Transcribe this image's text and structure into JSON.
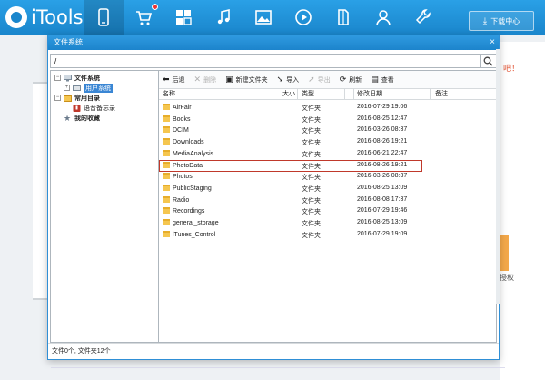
{
  "app": {
    "logo_text": "iTools",
    "download_label": "下载中心",
    "nav_icons": [
      "phone-icon",
      "store-icon",
      "apps-icon",
      "music-icon",
      "photos-icon",
      "video-icon",
      "books-icon",
      "contacts-icon",
      "tools-icon"
    ]
  },
  "background": {
    "warn_text": "吧！",
    "right_text": "授权"
  },
  "dialog": {
    "title": "文件系统",
    "close": "×",
    "path": "/",
    "tree": {
      "root": "文件系统",
      "user_system": "用户系统",
      "common_dirs": "常用目录",
      "voice_memos": "语音备忘录",
      "favorites": "我的收藏"
    },
    "toolbar": {
      "back": "后退",
      "delete": "删除",
      "new_folder": "新建文件夹",
      "import": "导入",
      "export": "导出",
      "refresh": "刷新",
      "view": "查看"
    },
    "columns": {
      "name": "名称",
      "size": "大小",
      "type": "类型",
      "modified": "修改日期",
      "note": "备注"
    },
    "rows": [
      {
        "name": "AirFair",
        "type": "文件夹",
        "modified": "2016-07-29 19:06"
      },
      {
        "name": "Books",
        "type": "文件夹",
        "modified": "2016-08-25 12:47"
      },
      {
        "name": "DCIM",
        "type": "文件夹",
        "modified": "2016-03-26 08:37"
      },
      {
        "name": "Downloads",
        "type": "文件夹",
        "modified": "2016-08-26 19:21"
      },
      {
        "name": "MediaAnalysis",
        "type": "文件夹",
        "modified": "2016-06-21 22:47"
      },
      {
        "name": "PhotoData",
        "type": "文件夹",
        "modified": "2016-08-26 19:21"
      },
      {
        "name": "Photos",
        "type": "文件夹",
        "modified": "2016-03-26 08:37"
      },
      {
        "name": "PublicStaging",
        "type": "文件夹",
        "modified": "2016-08-25 13:09"
      },
      {
        "name": "Radio",
        "type": "文件夹",
        "modified": "2016-08-08 17:37"
      },
      {
        "name": "Recordings",
        "type": "文件夹",
        "modified": "2016-07-29 19:46"
      },
      {
        "name": "general_storage",
        "type": "文件夹",
        "modified": "2016-08-25 13:09"
      },
      {
        "name": "iTunes_Control",
        "type": "文件夹",
        "modified": "2016-07-29 19:09"
      }
    ],
    "highlighted_row": "PhotoData",
    "status": "文件0个, 文件夹12个"
  },
  "colors": {
    "accent": "#1a86cc",
    "highlight": "#c0392b",
    "folder": "#f5c64f"
  }
}
